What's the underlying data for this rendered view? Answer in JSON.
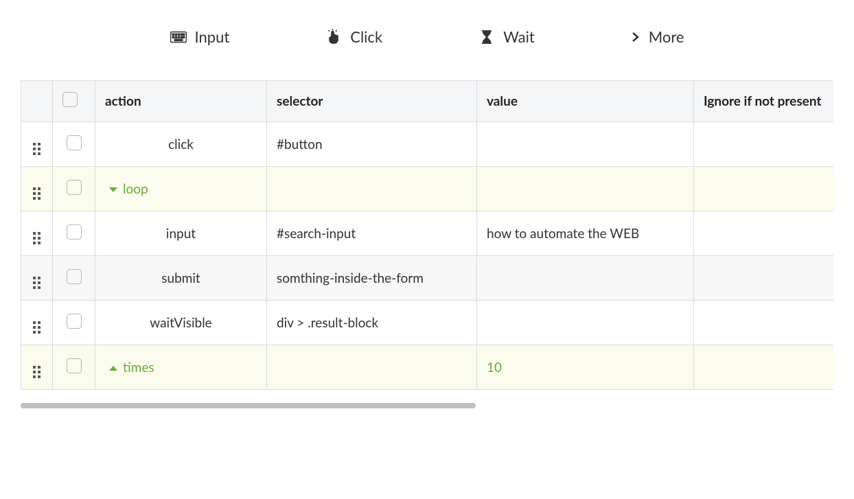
{
  "toolbar": {
    "input_label": "Input",
    "click_label": "Click",
    "wait_label": "Wait",
    "more_label": "More"
  },
  "columns": {
    "action": "action",
    "selector": "selector",
    "value": "value",
    "ignore": "Ignore if not present"
  },
  "rows": [
    {
      "type": "std",
      "action": "click",
      "selector": "#button",
      "value": ""
    },
    {
      "type": "loop-open",
      "action": "loop",
      "selector": "",
      "value": ""
    },
    {
      "type": "std",
      "action": "input",
      "selector": "#search-input",
      "value": "how to automate the WEB"
    },
    {
      "type": "std",
      "action": "submit",
      "selector": "somthing-inside-the-form",
      "value": ""
    },
    {
      "type": "std",
      "action": "waitVisible",
      "selector": "div > .result-block",
      "value": ""
    },
    {
      "type": "loop-close",
      "action": "times",
      "selector": "",
      "value": "10"
    }
  ]
}
